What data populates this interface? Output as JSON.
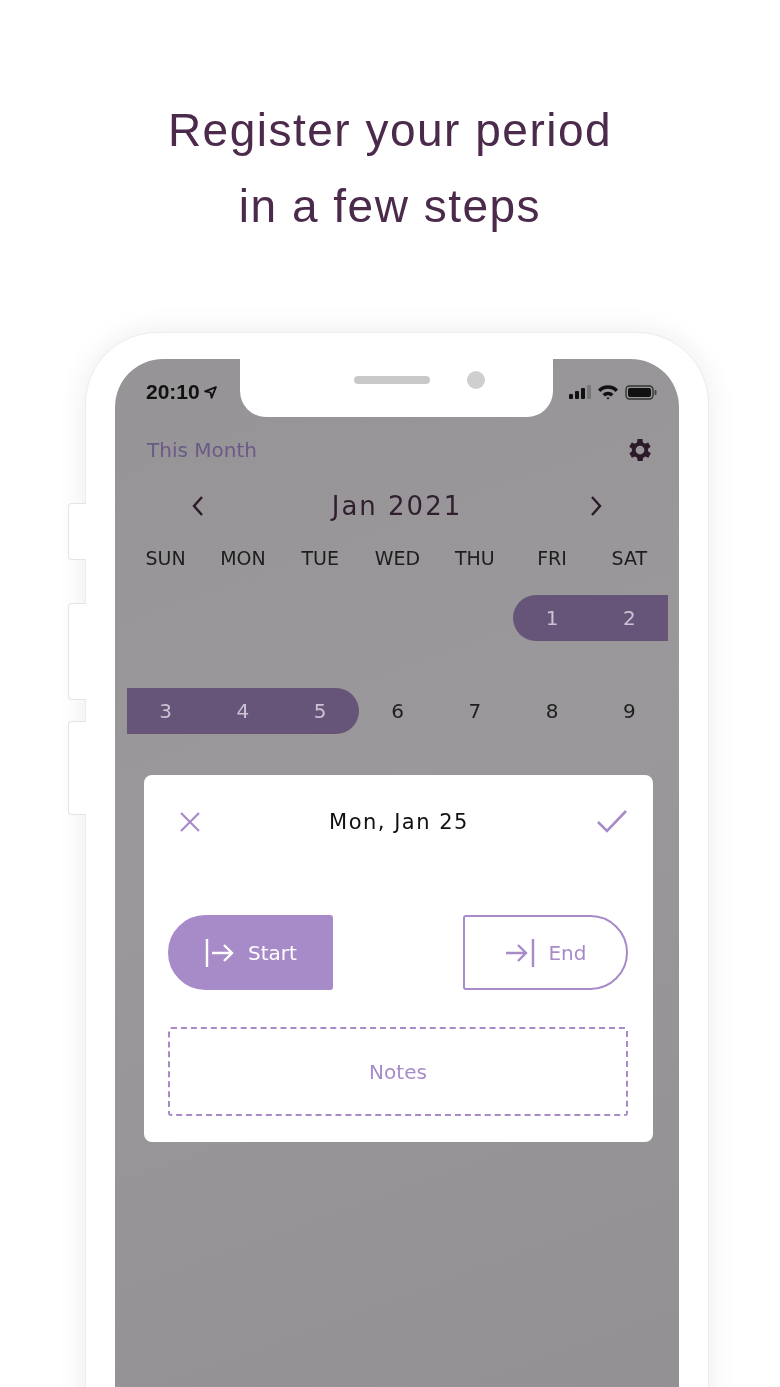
{
  "headline": [
    "Register your period",
    "in a few steps"
  ],
  "status_bar": {
    "time": "20:10"
  },
  "calendar": {
    "label": "This Month",
    "month": "Jan 2021",
    "weekdays": [
      "SUN",
      "MON",
      "TUE",
      "WED",
      "THU",
      "FRI",
      "SAT"
    ],
    "weeks": [
      {
        "days": [
          {
            "kind": "blank"
          },
          {
            "kind": "blank"
          },
          {
            "kind": "blank"
          },
          {
            "kind": "blank"
          },
          {
            "kind": "blank"
          },
          {
            "kind": "day",
            "day": "1",
            "period": true
          },
          {
            "kind": "day",
            "day": "2",
            "period": true
          }
        ]
      },
      {
        "days": [
          {
            "day": "3",
            "period": true
          },
          {
            "day": "4",
            "period": true
          },
          {
            "day": "5",
            "period": true
          },
          {
            "day": "6",
            "period": false
          },
          {
            "day": "7",
            "period": false
          },
          {
            "day": "8",
            "period": false
          },
          {
            "day": "9",
            "period": false
          }
        ]
      }
    ]
  },
  "dialog": {
    "title": "Mon, Jan 25",
    "buttons": [
      {
        "kind": "start",
        "label": "Start",
        "selected": true
      },
      {
        "kind": "end",
        "label": "End",
        "selected": false
      }
    ],
    "notes": {
      "placeholder": "Notes"
    }
  }
}
